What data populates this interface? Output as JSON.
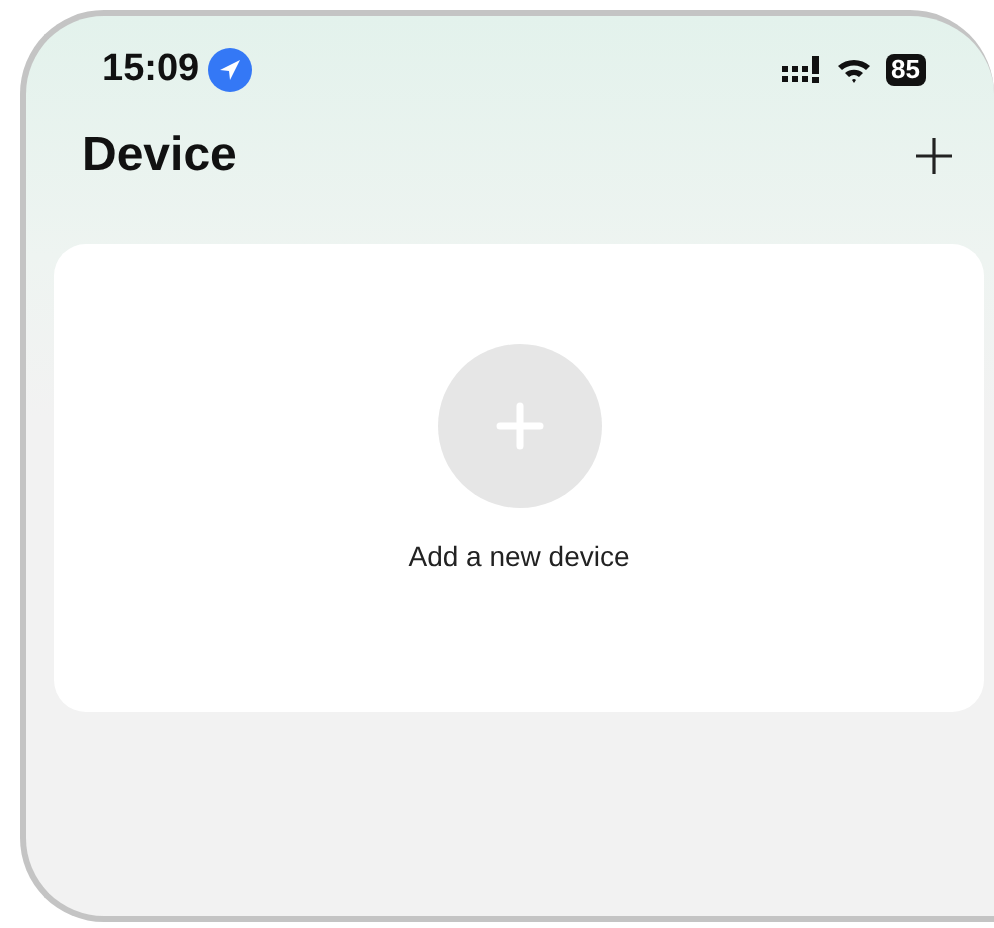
{
  "status_bar": {
    "time": "15:09",
    "battery": "85"
  },
  "header": {
    "title": "Device"
  },
  "empty_card": {
    "label": "Add a new device"
  }
}
